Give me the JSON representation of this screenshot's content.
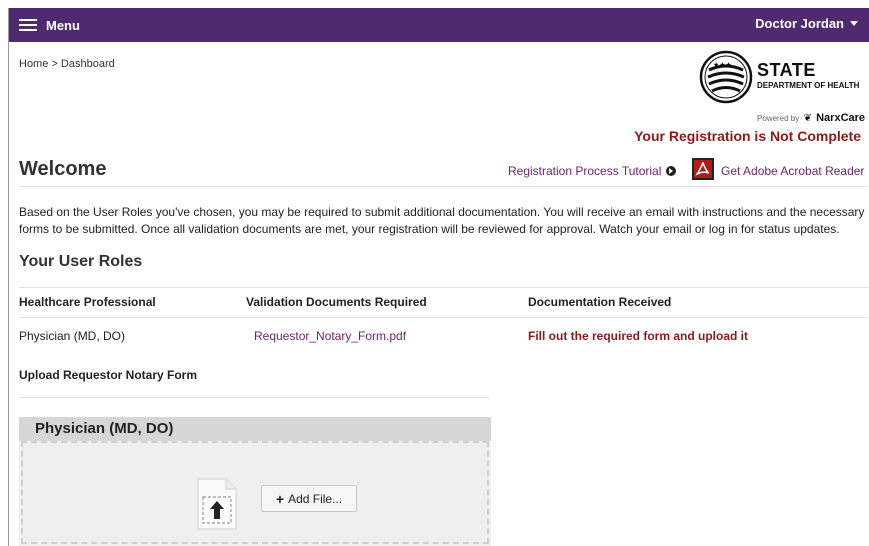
{
  "topbar": {
    "menu_label": "Menu",
    "user_name": "Doctor Jordan"
  },
  "breadcrumb": {
    "home": "Home",
    "separator": ">",
    "current": "Dashboard"
  },
  "logo": {
    "state": "STATE",
    "department": "DEPARTMENT OF HEALTH",
    "powered_by": "Powered by",
    "brand": "NarxCare"
  },
  "registration_warning": "Your Registration is Not Complete",
  "welcome_title": "Welcome",
  "links": {
    "tutorial": "Registration Process Tutorial",
    "acrobat": "Get Adobe Acrobat Reader"
  },
  "intro_text": "Based on the User Roles you've chosen, you may be required to submit additional documentation. You will receive an email with instructions and the necessary forms to be submitted. Once all validation documents are met, your registration will be reviewed for approval. Watch your email or log in for status updates.",
  "roles": {
    "title": "Your User Roles",
    "columns": [
      "Healthcare Professional",
      "Validation Documents Required",
      "Documentation Received"
    ],
    "rows": [
      {
        "role": "Physician (MD, DO)",
        "document": "Requestor_Notary_Form.pdf",
        "status": "Fill out the required form and upload it"
      }
    ]
  },
  "upload": {
    "title": "Upload Requestor Notary Form",
    "panel_title": "Physician (MD, DO)",
    "add_file_label": "Add File..."
  },
  "colors": {
    "topbar": "#4f2a6e",
    "link": "#6e2470",
    "warning": "#8b1a1a"
  }
}
